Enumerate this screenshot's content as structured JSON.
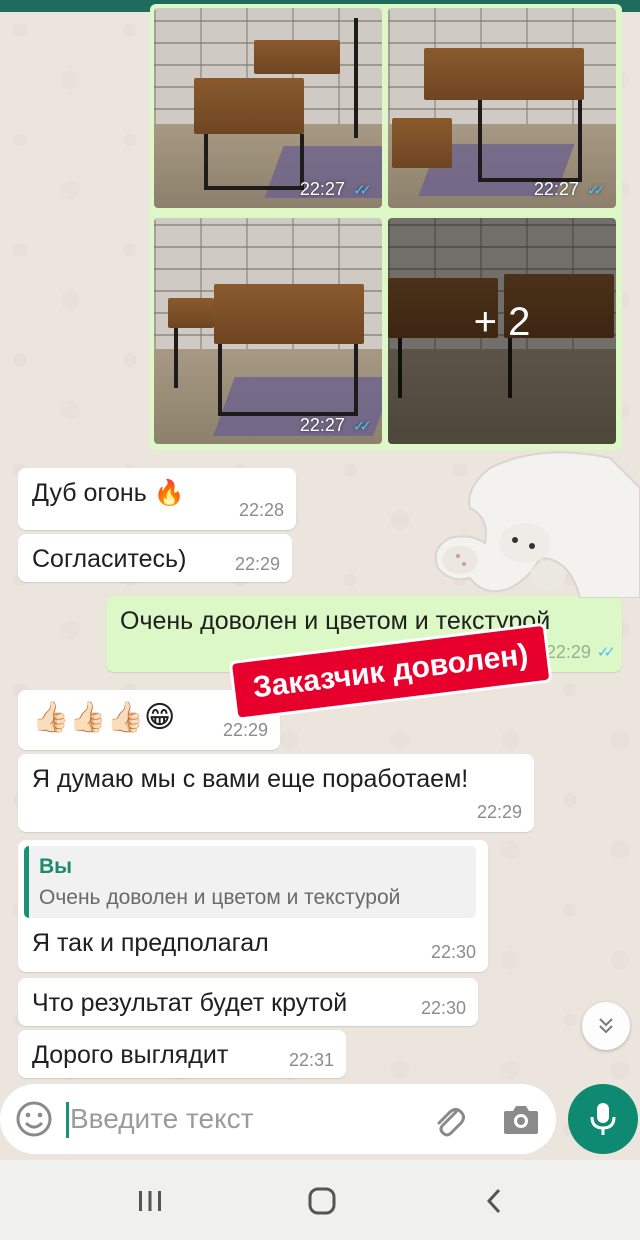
{
  "photos": [
    {
      "time": "22:27",
      "status": "read"
    },
    {
      "time": "22:27",
      "status": "read"
    },
    {
      "time": "22:27",
      "status": "read"
    },
    {
      "more_count": "+ 2"
    }
  ],
  "messages": [
    {
      "dir": "in",
      "text": "Дуб огонь",
      "emoji": "🔥",
      "time": "22:28"
    },
    {
      "dir": "in",
      "text": "Согласитесь)",
      "time": "22:29"
    },
    {
      "dir": "out",
      "text": "Очень доволен и цветом и текстурой",
      "time": "22:29",
      "status": "read"
    },
    {
      "dir": "in",
      "text": "👍🏻👍🏻👍🏻😁",
      "time": "22:29"
    },
    {
      "dir": "in",
      "text": "Я думаю мы с вами еще поработаем!",
      "time": "22:29"
    },
    {
      "dir": "in",
      "reply": {
        "author": "Вы",
        "text": "Очень доволен и цветом и текстурой"
      },
      "text": "Я так и предполагал",
      "time": "22:30"
    },
    {
      "dir": "in",
      "text": "Что результат будет крутой",
      "time": "22:30"
    },
    {
      "dir": "in",
      "text": "Дорого выглядит",
      "time": "22:31"
    }
  ],
  "sticker_text": "Заказчик доволен)",
  "composer": {
    "placeholder": "Введите текст"
  },
  "icons": {
    "emoji": "emoji-icon",
    "attach": "paperclip-icon",
    "camera": "camera-icon",
    "mic": "mic-icon",
    "scroll": "chevron-down-double-icon",
    "nav_recent": "recent-apps-icon",
    "nav_home": "home-icon",
    "nav_back": "back-icon"
  },
  "colors": {
    "accent": "#0e8a72",
    "outgoing": "#dcf8c6",
    "incoming": "#ffffff",
    "sticker": "#e8002d",
    "read_ticks": "#4fc3f7"
  }
}
